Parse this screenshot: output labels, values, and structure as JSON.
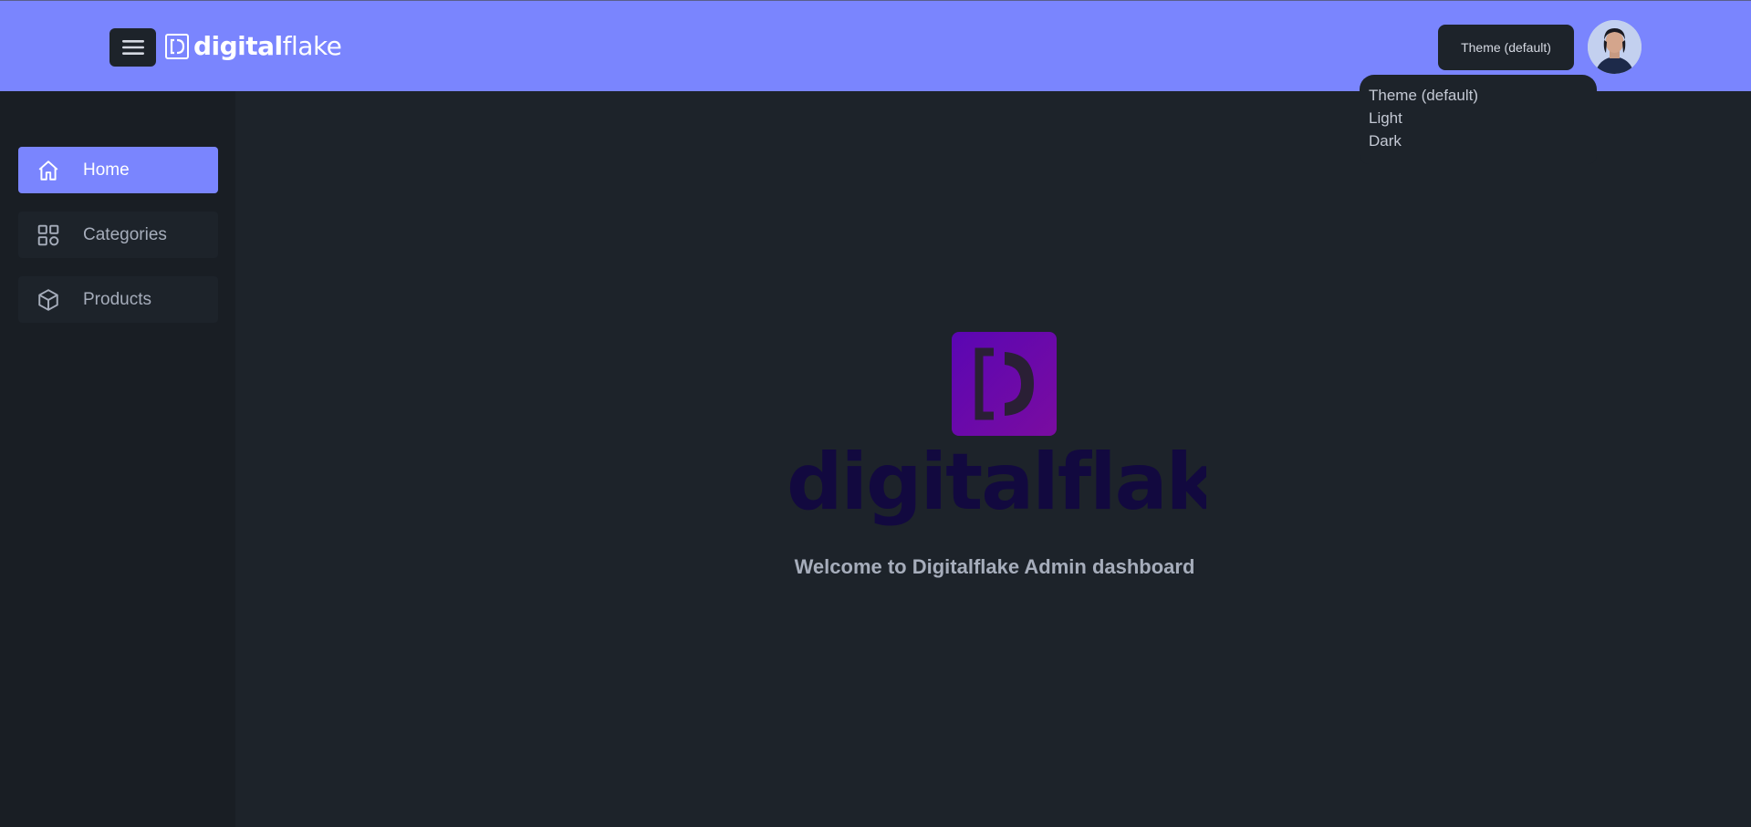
{
  "header": {
    "logo_bold": "digital",
    "logo_light": "flake",
    "theme_button_label": "Theme (default)"
  },
  "theme_menu": {
    "options": [
      "Theme (default)",
      "Light",
      "Dark"
    ]
  },
  "sidebar": {
    "items": [
      {
        "label": "Home",
        "icon": "home-icon",
        "active": true
      },
      {
        "label": "Categories",
        "icon": "grid-icon",
        "active": false
      },
      {
        "label": "Products",
        "icon": "box-icon",
        "active": false
      }
    ]
  },
  "main": {
    "brand_word": "digitalflake",
    "welcome_text": "Welcome to Digitalflake Admin dashboard"
  },
  "colors": {
    "accent": "#7a85fe",
    "background": "#1d232a",
    "sidebar": "#191e24",
    "hero_logo": "#6a08ab",
    "hero_word": "#12093f"
  }
}
